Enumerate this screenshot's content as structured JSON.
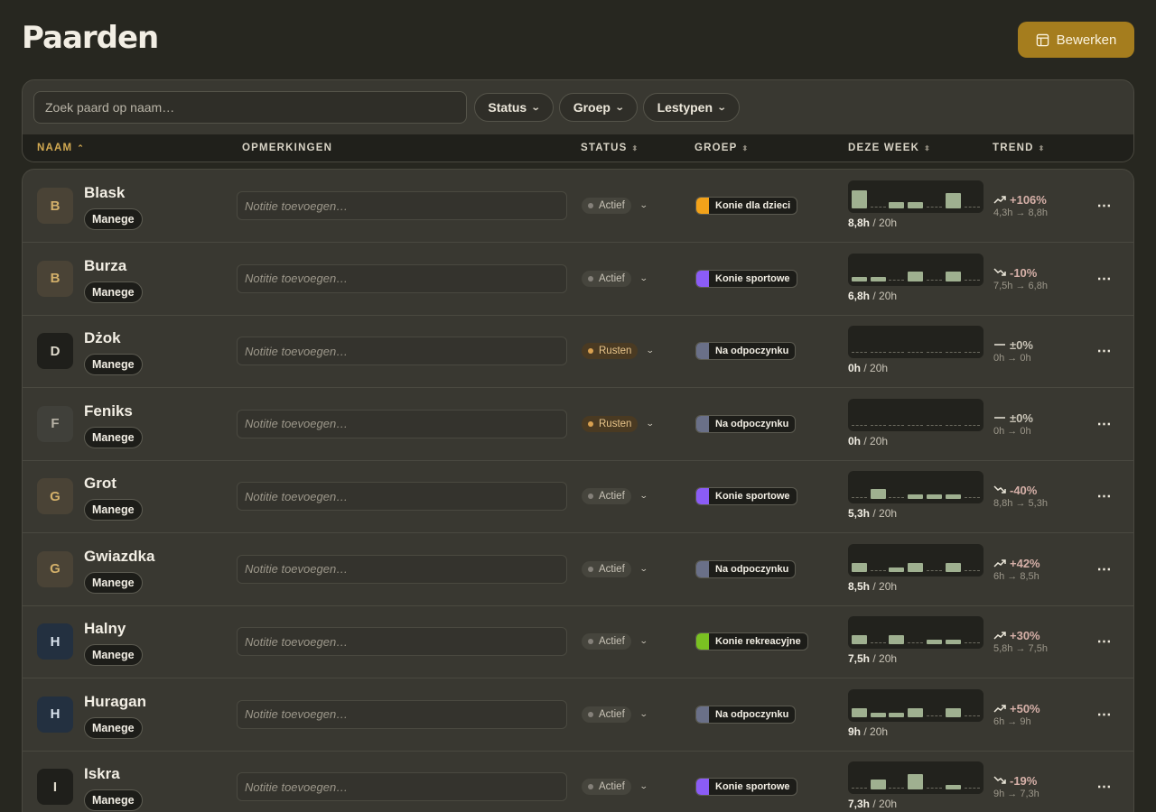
{
  "page": {
    "title": "Paarden",
    "edit_button": "Bewerken"
  },
  "filters": {
    "search_placeholder": "Zoek paard op naam…",
    "status": "Status",
    "group": "Groep",
    "lesson_types": "Lestypen"
  },
  "columns": {
    "name": "NAAM",
    "notes": "OPMERKINGEN",
    "status": "STATUS",
    "group": "GROEP",
    "this_week": "DEZE WEEK",
    "trend": "TREND"
  },
  "note_placeholder": "Notitie toevoegen…",
  "colors": {
    "accent": "#a57d1e",
    "active_sort": "#d3aa52",
    "bar": "#9fb090",
    "trend_up": "#d6b0a8",
    "status_active": "#85817a",
    "status_rest": "#d8a050"
  },
  "horses": [
    {
      "initial": "B",
      "name": "Blask",
      "tag": "Manege",
      "avatar": "#4a4336",
      "avatar_text": "#d3b06a",
      "status": "Actief",
      "status_type": "active",
      "group": "Konie dla dzieci",
      "group_color": "#f2a21a",
      "bars": [
        4,
        0,
        1.4,
        1.4,
        0,
        3.4,
        0
      ],
      "hours": "8,8h",
      "target": "/ 20h",
      "trend": "+106%",
      "trend_dir": "up",
      "trend_detail": "4,3h → 8,8h"
    },
    {
      "initial": "B",
      "name": "Burza",
      "tag": "Manege",
      "avatar": "#4a4336",
      "avatar_text": "#d3b06a",
      "status": "Actief",
      "status_type": "active",
      "group": "Konie sportowe",
      "group_color": "#8b5cf6",
      "bars": [
        1,
        1,
        0,
        2.2,
        0,
        2.2,
        0
      ],
      "hours": "6,8h",
      "target": "/ 20h",
      "trend": "-10%",
      "trend_dir": "down",
      "trend_detail": "7,5h → 6,8h"
    },
    {
      "initial": "D",
      "name": "Dżok",
      "tag": "Manege",
      "avatar": "#1f1f1b",
      "avatar_text": "#e0dbcd",
      "status": "Rusten",
      "status_type": "rest",
      "group": "Na odpoczynku",
      "group_color": "#6a7088",
      "bars": [
        0,
        0,
        0,
        0,
        0,
        0,
        0
      ],
      "hours": "0h",
      "target": "/ 20h",
      "trend": "±0%",
      "trend_dir": "flat",
      "trend_detail": "0h → 0h"
    },
    {
      "initial": "F",
      "name": "Feniks",
      "tag": "Manege",
      "avatar": "#40403a",
      "avatar_text": "#b7b2a5",
      "status": "Rusten",
      "status_type": "rest",
      "group": "Na odpoczynku",
      "group_color": "#6a7088",
      "bars": [
        0,
        0,
        0,
        0,
        0,
        0,
        0
      ],
      "hours": "0h",
      "target": "/ 20h",
      "trend": "±0%",
      "trend_dir": "flat",
      "trend_detail": "0h → 0h"
    },
    {
      "initial": "G",
      "name": "Grot",
      "tag": "Manege",
      "avatar": "#4a4336",
      "avatar_text": "#d3b06a",
      "status": "Actief",
      "status_type": "active",
      "group": "Konie sportowe",
      "group_color": "#8b5cf6",
      "bars": [
        0,
        2.2,
        0,
        1,
        1,
        1,
        0
      ],
      "hours": "5,3h",
      "target": "/ 20h",
      "trend": "-40%",
      "trend_dir": "down",
      "trend_detail": "8,8h → 5,3h"
    },
    {
      "initial": "G",
      "name": "Gwiazdka",
      "tag": "Manege",
      "avatar": "#4a4336",
      "avatar_text": "#d3b06a",
      "status": "Actief",
      "status_type": "active",
      "group": "Na odpoczynku",
      "group_color": "#6a7088",
      "bars": [
        2,
        0,
        1,
        2,
        0,
        2,
        0
      ],
      "hours": "8,5h",
      "target": "/ 20h",
      "trend": "+42%",
      "trend_dir": "up",
      "trend_detail": "6h → 8,5h"
    },
    {
      "initial": "H",
      "name": "Halny",
      "tag": "Manege",
      "avatar": "#233040",
      "avatar_text": "#d9e2ec",
      "status": "Actief",
      "status_type": "active",
      "group": "Konie rekreacyjne",
      "group_color": "#7ac122",
      "bars": [
        2,
        0,
        2,
        0,
        1,
        1,
        0
      ],
      "hours": "7,5h",
      "target": "/ 20h",
      "trend": "+30%",
      "trend_dir": "up",
      "trend_detail": "5,8h → 7,5h"
    },
    {
      "initial": "H",
      "name": "Huragan",
      "tag": "Manege",
      "avatar": "#233040",
      "avatar_text": "#d9e2ec",
      "status": "Actief",
      "status_type": "active",
      "group": "Na odpoczynku",
      "group_color": "#6a7088",
      "bars": [
        2,
        1,
        1,
        2,
        0,
        2,
        0
      ],
      "hours": "9h",
      "target": "/ 20h",
      "trend": "+50%",
      "trend_dir": "up",
      "trend_detail": "6h → 9h"
    },
    {
      "initial": "I",
      "name": "Iskra",
      "tag": "Manege",
      "avatar": "#1f1f1b",
      "avatar_text": "#e0dbcd",
      "status": "Actief",
      "status_type": "active",
      "group": "Konie sportowe",
      "group_color": "#8b5cf6",
      "bars": [
        0,
        2.2,
        0,
        3.4,
        0,
        1,
        0
      ],
      "hours": "7,3h",
      "target": "/ 20h",
      "trend": "-19%",
      "trend_dir": "down",
      "trend_detail": "9h → 7,3h"
    }
  ]
}
